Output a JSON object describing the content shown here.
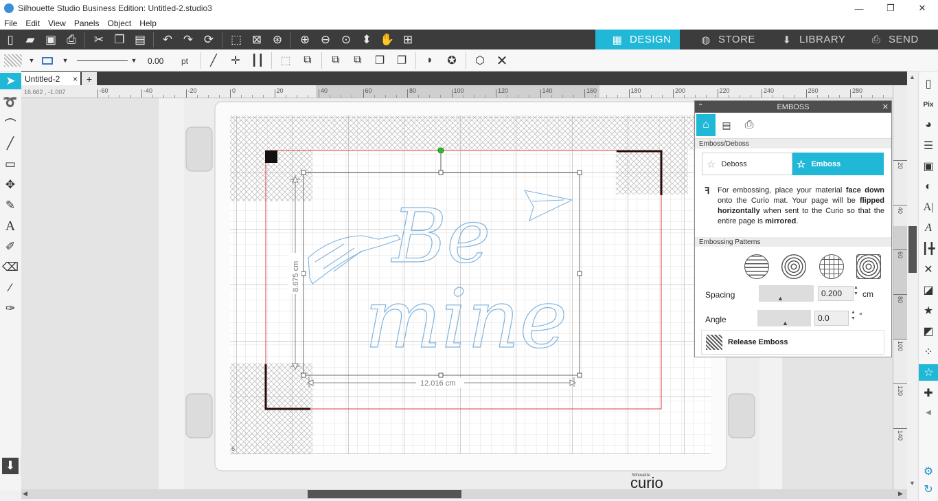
{
  "window": {
    "title": "Silhouette Studio Business Edition: Untitled-2.studio3",
    "controls": {
      "minimize": "—",
      "restore": "❐",
      "close": "✕"
    }
  },
  "menu": [
    "File",
    "Edit",
    "View",
    "Panels",
    "Object",
    "Help"
  ],
  "mode_tabs": [
    {
      "label": "DESIGN",
      "icon": "grid-icon",
      "active": true
    },
    {
      "label": "STORE",
      "icon": "silhouette-s-icon",
      "active": false
    },
    {
      "label": "LIBRARY",
      "icon": "library-icon",
      "active": false
    },
    {
      "label": "SEND",
      "icon": "send-icon",
      "active": false
    }
  ],
  "line_settings": {
    "width_value": "0.00",
    "unit": "pt"
  },
  "document": {
    "tab_label": "Untitled-2",
    "close": "×",
    "new_tab": "+"
  },
  "cursor_coords": "16.662 , -1.007",
  "ruler": {
    "top_ticks": [
      "-60",
      "-40",
      "-20",
      "0",
      "20",
      "40",
      "60",
      "80",
      "100",
      "120",
      "140",
      "160",
      "180",
      "200",
      "220",
      "240",
      "260",
      "280"
    ],
    "right_ticks": [
      "20",
      "40",
      "60",
      "80",
      "100",
      "120",
      "140"
    ]
  },
  "canvas": {
    "page_number": "6",
    "dimension_height": "8.675 cm",
    "dimension_width": "12.016 cm",
    "design_text_1": "Be",
    "design_text_2": "mine",
    "brand_small": "Silhouette",
    "brand": "curio"
  },
  "emboss_panel": {
    "title": "EMBOSS",
    "section1": "Emboss/Deboss",
    "deboss_label": "Deboss",
    "emboss_label": "Emboss",
    "info_parts": [
      {
        "t": "For embossing, place your material ",
        "b": false
      },
      {
        "t": "face down",
        "b": true
      },
      {
        "t": " onto the Curio mat. Your page will be ",
        "b": false
      },
      {
        "t": "flipped horizontally",
        "b": true
      },
      {
        "t": " when sent to the Curio so that the entire page is ",
        "b": false
      },
      {
        "t": "mirrored",
        "b": true
      },
      {
        "t": ".",
        "b": false
      }
    ],
    "section2": "Embossing Patterns",
    "spacing_label": "Spacing",
    "spacing_value": "0.200",
    "spacing_unit": "cm",
    "angle_label": "Angle",
    "angle_value": "0.0",
    "angle_unit": "°",
    "release_label": "Release Emboss",
    "accent": "#21b8d8"
  },
  "colors": {
    "accent": "#21b8d8",
    "toolbar_dark": "#3c3c3c",
    "cut_line_red": "#e03a3a",
    "design_blue": "#7fb3de",
    "arrow_red": "#e01010"
  }
}
